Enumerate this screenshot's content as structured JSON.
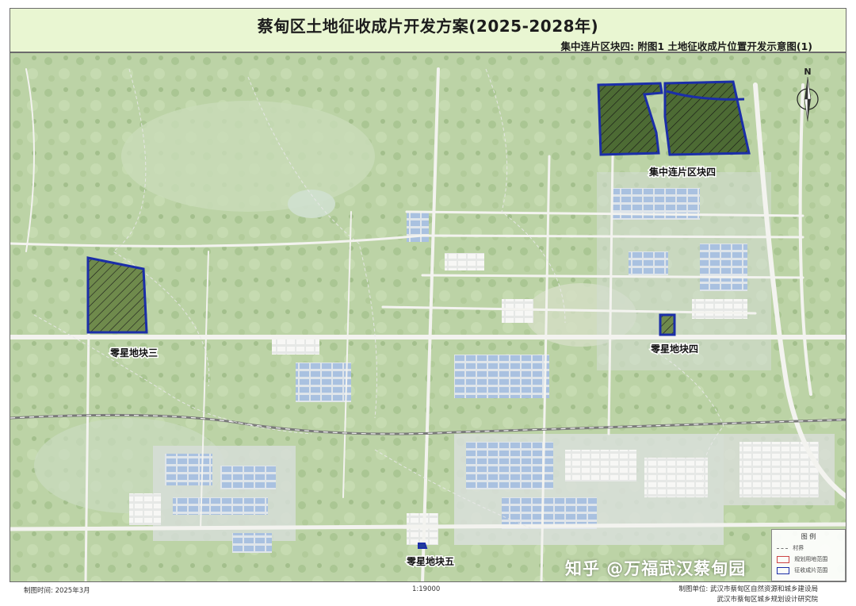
{
  "header": {
    "title": "蔡甸区土地征收成片开发方案(2025-2028年)",
    "subtitle": "集中连片区块四:  附图1 土地征收成片位置开发示意图(1)"
  },
  "map": {
    "labels": {
      "block4_concentrated": "集中连片区块四",
      "scattered3": "零星地块三",
      "scattered4": "零星地块四",
      "scattered5": "零星地块五"
    },
    "compass_north": "N",
    "colors": {
      "parcel_border": "#1b2ea8",
      "parcel_hatch": "#1a1a1a",
      "background_green": "#b7cfa1",
      "road": "#f4f4f4",
      "building_blue": "#9fb9dc"
    }
  },
  "legend": {
    "title": "图 例",
    "rows": [
      "村界",
      "规划用地范围",
      "征收成片范围"
    ]
  },
  "footer": {
    "date": "制图时间: 2025年3月",
    "scale": "1:19000",
    "unit_line1": "制图单位: 武汉市蔡甸区自然资源和城乡建设局",
    "unit_line2": "武汉市蔡甸区城乡规划设计研究院"
  },
  "watermark": "知乎 @万福武汉蔡甸园"
}
